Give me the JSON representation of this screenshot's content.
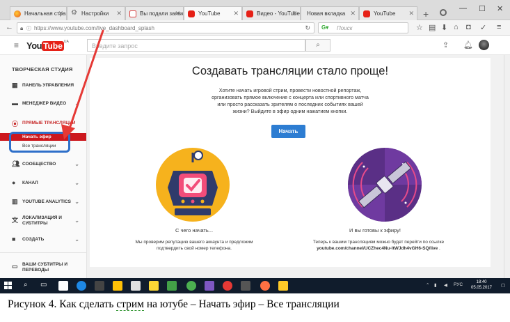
{
  "browser": {
    "tabs": [
      {
        "label": "Начальная стран"
      },
      {
        "label": "Настройки"
      },
      {
        "label": "Вы подали заявк"
      },
      {
        "label": "YouTube"
      },
      {
        "label": "Видео - YouTube"
      },
      {
        "label": "Новая вкладка"
      },
      {
        "label": "YouTube"
      }
    ],
    "url": "https://www.youtube.com/live_dashboard_splash",
    "search_placeholder": "Поиск"
  },
  "youtube": {
    "logo_you": "You",
    "logo_tube": "Tube",
    "logo_region": "UA",
    "search_placeholder": "Введите запрос"
  },
  "sidebar": {
    "studio_title": "ТВОРЧЕСКАЯ СТУДИЯ",
    "items": [
      {
        "label": "ПАНЕЛЬ УПРАВЛЕНИЯ"
      },
      {
        "label": "МЕНЕДЖЕР ВИДЕО"
      },
      {
        "label": "ПРЯМЫЕ ТРАНСЛЯЦИИ"
      },
      {
        "label": "СООБЩЕСТВО"
      },
      {
        "label": "КАНАЛ"
      },
      {
        "label": "YOUTUBE ANALYTICS"
      },
      {
        "label_line1": "ЛОКАЛИЗАЦИЯ И",
        "label_line2": "СУБТИТРЫ"
      },
      {
        "label": "СОЗДАТЬ"
      },
      {
        "label_line1": "ВАШИ СУБТИТРЫ И",
        "label_line2": "ПЕРЕВОДЫ"
      }
    ],
    "sub_items": [
      {
        "label": "Начать эфир"
      },
      {
        "label": "Все трансляции"
      }
    ]
  },
  "main": {
    "headline": "Создавать трансляции стало проще!",
    "lead_lines": [
      "Хотите начать игровой стрим, провести новостной репортаж,",
      "организовать прямое включение с концерта или спортивного матча",
      "или просто рассказать зрителям о последних событиях вашей",
      "жизни? Выйдите в эфир одним нажатием кнопки."
    ],
    "start_button": "Начать",
    "left_caption": "С чего начать...",
    "left_text_lines": [
      "Мы проверим репутацию вашего аккаунта и предложим",
      "подтвердить свой номер телефона."
    ],
    "right_caption": "И вы готовы к эфиру!",
    "right_text_line1": "Теперь к вашим трансляциям можно будет перейти по ссылке",
    "right_link": "youtube.com/channel/UCZhec4Nu-ltWJdh4vGH6-SQ/live",
    "right_text_end": " ."
  },
  "taskbar": {
    "lang": "РУС",
    "time": "18:40",
    "date": "05.05.2017"
  },
  "figure_caption": {
    "before": "Рисунок 4. Как сделать ",
    "underlined": "стрим",
    "after": " на ютубе – Начать эфир – Все трансляции"
  },
  "colors": {
    "accent_red": "#cc181e",
    "button_blue": "#2d7dd2",
    "highlight_blue": "#2e6fc9",
    "annotation_arrow": "#e53935"
  }
}
